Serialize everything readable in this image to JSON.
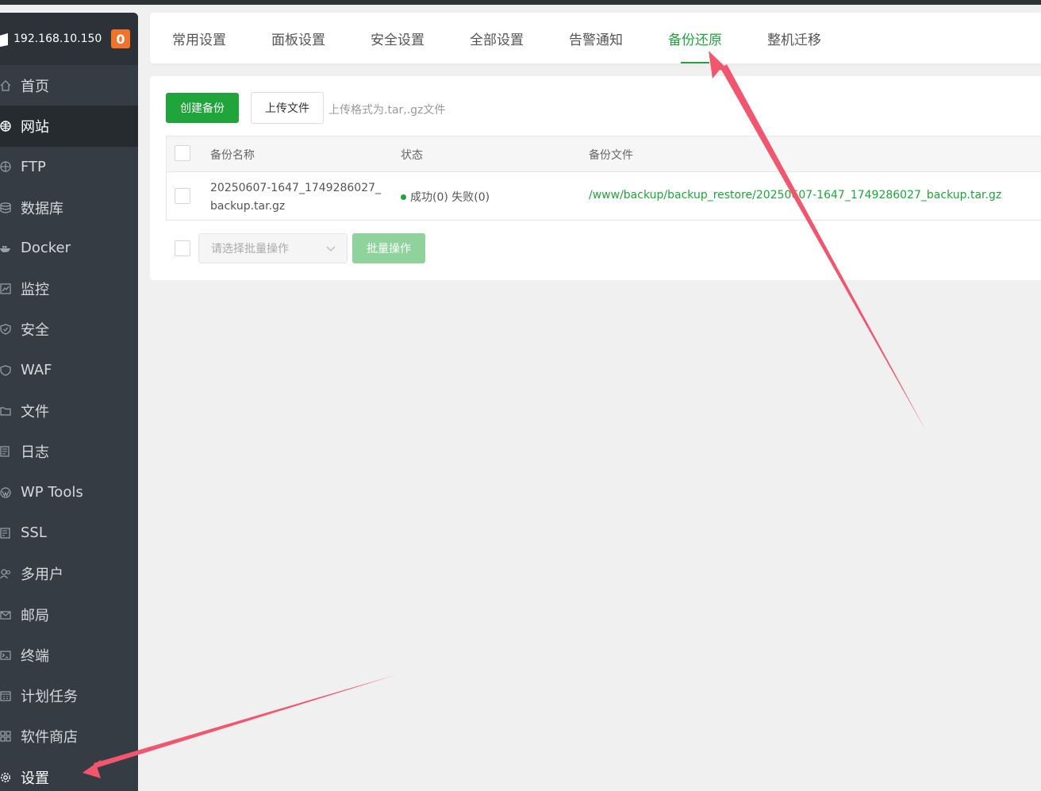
{
  "sidebar": {
    "server_ip": "192.168.10.150",
    "badge_count": "0",
    "items": [
      {
        "label": "首页",
        "icon": "home-icon"
      },
      {
        "label": "网站",
        "icon": "globe-icon"
      },
      {
        "label": "FTP",
        "icon": "ftp-icon"
      },
      {
        "label": "数据库",
        "icon": "database-icon"
      },
      {
        "label": "Docker",
        "icon": "docker-icon"
      },
      {
        "label": "监控",
        "icon": "monitor-icon"
      },
      {
        "label": "安全",
        "icon": "shield-icon"
      },
      {
        "label": "WAF",
        "icon": "waf-icon"
      },
      {
        "label": "文件",
        "icon": "folder-icon"
      },
      {
        "label": "日志",
        "icon": "log-icon"
      },
      {
        "label": "WP Tools",
        "icon": "wordpress-icon"
      },
      {
        "label": "SSL",
        "icon": "ssl-icon"
      },
      {
        "label": "多用户",
        "icon": "users-icon"
      },
      {
        "label": "邮局",
        "icon": "mail-icon"
      },
      {
        "label": "终端",
        "icon": "terminal-icon"
      },
      {
        "label": "计划任务",
        "icon": "calendar-icon"
      },
      {
        "label": "软件商店",
        "icon": "apps-icon"
      },
      {
        "label": "设置",
        "icon": "gear-icon"
      }
    ],
    "active_item": "网站"
  },
  "tabs": {
    "items": [
      "常用设置",
      "面板设置",
      "安全设置",
      "全部设置",
      "告警通知",
      "备份还原",
      "整机迁移"
    ],
    "active": "备份还原"
  },
  "toolbar": {
    "create_label": "创建备份",
    "upload_label": "上传文件",
    "upload_hint": "上传格式为.tar,.gz文件"
  },
  "table": {
    "headers": [
      "备份名称",
      "状态",
      "备份文件"
    ],
    "rows": [
      {
        "name_line1": "20250607-1647_1749286027_",
        "name_line2": "backup.tar.gz",
        "status": "成功(0) 失败(0)",
        "file": "/www/backup/backup_restore/20250607-1647_1749286027_backup.tar.gz"
      }
    ]
  },
  "batch": {
    "select_placeholder": "请选择批量操作",
    "button_label": "批量操作"
  },
  "colors": {
    "accent": "#20a53a",
    "sidebar_bg": "#353c43",
    "badge": "#f0732c",
    "annotation_arrow": "#f2566e"
  }
}
